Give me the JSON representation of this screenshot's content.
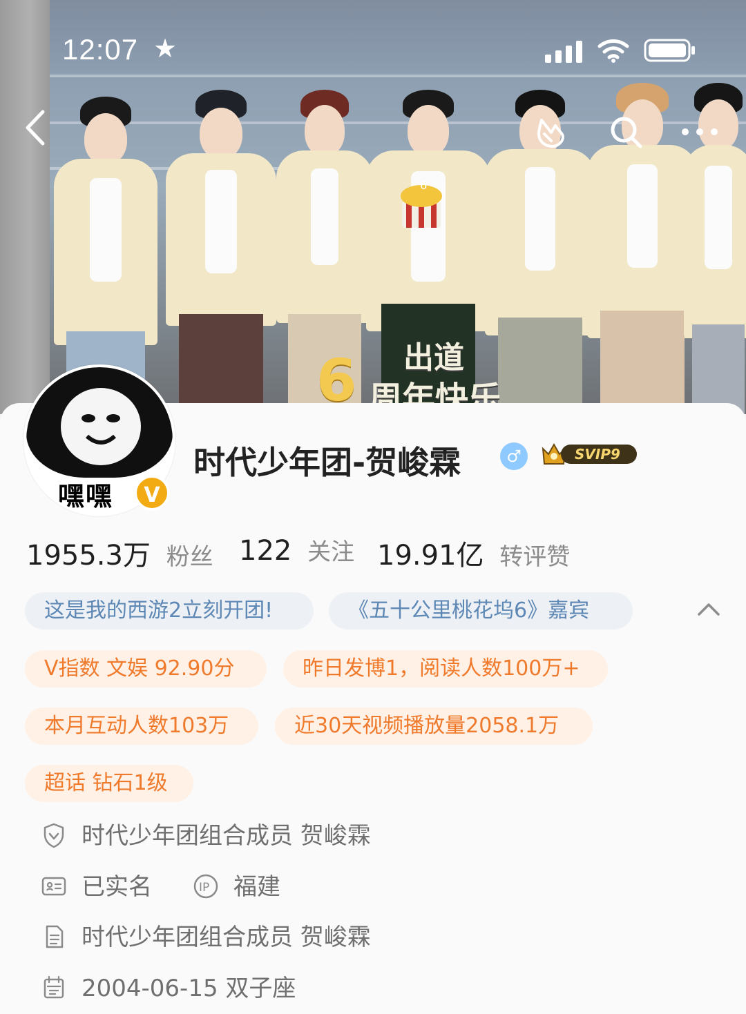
{
  "status_bar": {
    "time": "12:07"
  },
  "header": {
    "overlay_text_top": "出道",
    "overlay_six": "6",
    "overlay_text_bottom": "周年快乐",
    "cake_number": "6"
  },
  "profile": {
    "avatar_text": "嘿嘿",
    "verify_badge": "V",
    "name": "时代少年团-贺峻霖",
    "gender_symbol": "♂",
    "svip_label": "SVIP9"
  },
  "stats": [
    {
      "num": "1955.3万",
      "label": "粉丝"
    },
    {
      "num": "122",
      "label": "关注"
    },
    {
      "num": "19.91亿",
      "label": "转评赞"
    }
  ],
  "chips": [
    {
      "text": "这是我的西游2立刻开团!",
      "style": "blue"
    },
    {
      "text": "《五十公里桃花坞6》嘉宾",
      "style": "blue"
    },
    {
      "text": "V指数 文娱 92.90分",
      "style": "orange"
    },
    {
      "text": "昨日发博1，阅读人数100万+",
      "style": "orange"
    },
    {
      "text": "本月互动人数103万",
      "style": "orange"
    },
    {
      "text": "近30天视频播放量2058.1万",
      "style": "orange"
    },
    {
      "text": "超话 钻石1级",
      "style": "orange"
    }
  ],
  "info": {
    "role": "时代少年团组合成员 贺峻霖",
    "real_name": "已实名",
    "ip_location": "福建",
    "bio": "时代少年团组合成员 贺峻霖",
    "birthday": "2004-06-15 双子座"
  },
  "icons": {
    "back": "back-arrow-icon",
    "handshake": "heart-hand-icon",
    "search": "search-icon",
    "more": "more-icon",
    "collapse": "chevron-up-icon",
    "shield": "shield-icon",
    "id": "id-card-icon",
    "ip": "ip-icon",
    "doc": "document-icon",
    "calendar": "calendar-icon"
  },
  "colors": {
    "chip_blue_bg": "#edf1f5",
    "chip_blue_text": "#5d87b5",
    "chip_orange_bg": "#fff1e6",
    "chip_orange_text": "#f07a2c",
    "verify": "#f2ab12",
    "gender": "#8ec9ff"
  }
}
